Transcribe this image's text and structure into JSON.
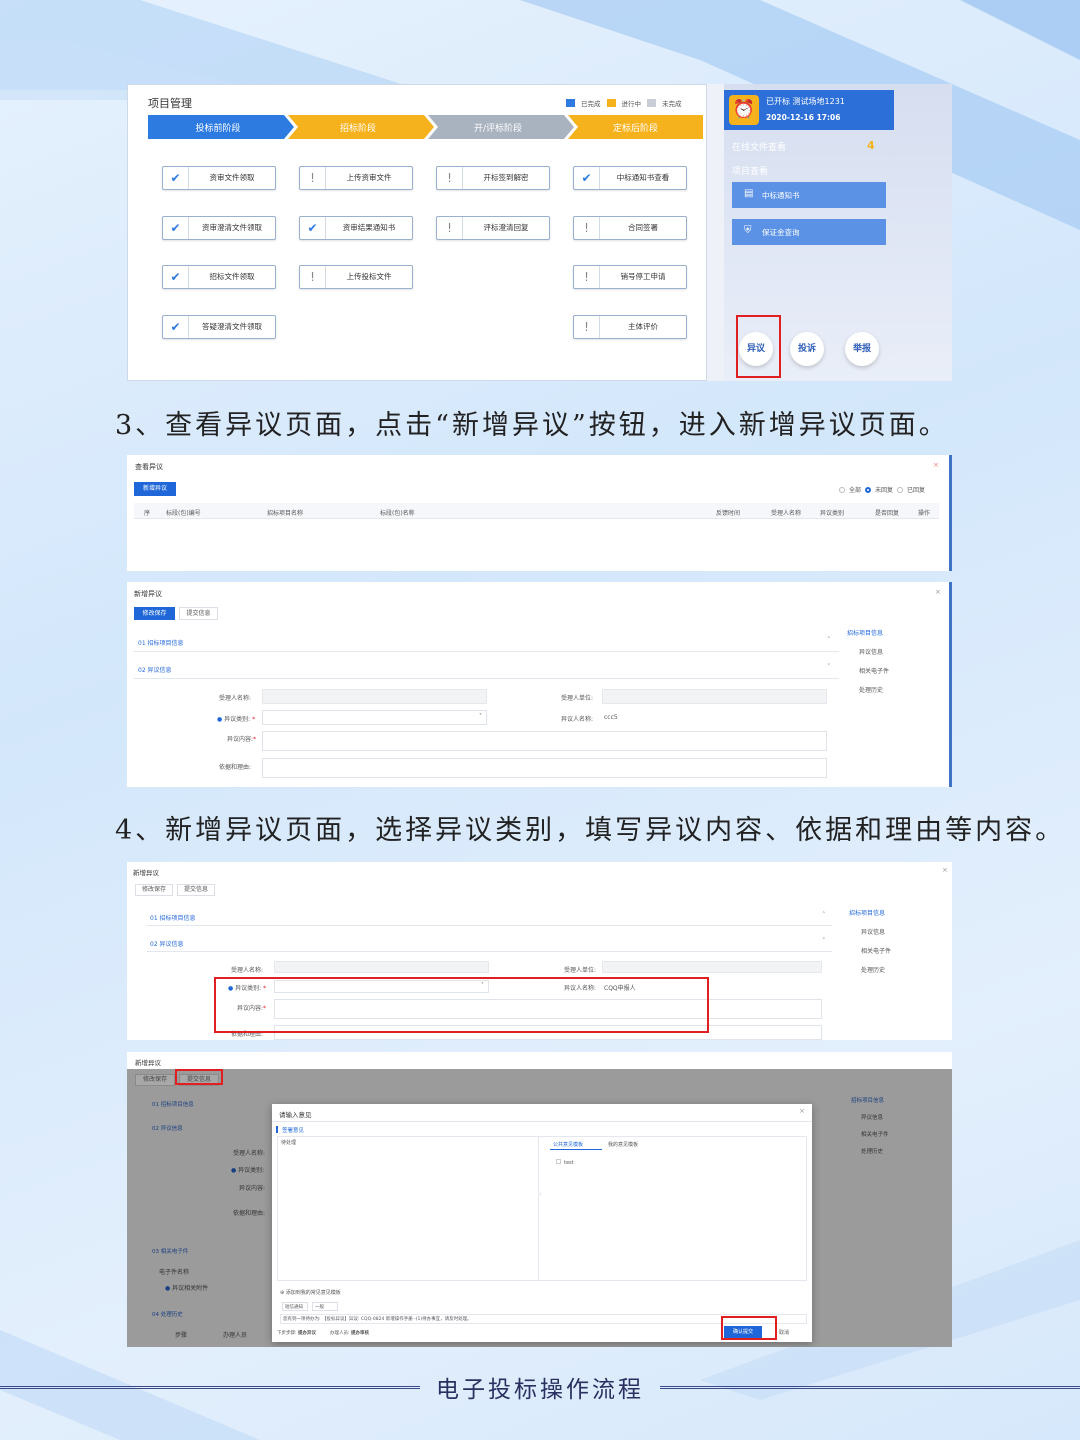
{
  "footer_title": "电子投标操作流程",
  "captions": {
    "step3": "3、查看异议页面，点击“新增异议”按钮，进入新增异议页面。",
    "step4": "4、新增异议页面，选择异议类别，填写异议内容、依据和理由等内容。"
  },
  "shot1": {
    "title": "项目管理",
    "legend": [
      "已完成",
      "进行中",
      "未完成"
    ],
    "stages": [
      "投标前阶段",
      "招标阶段",
      "开/评标阶段",
      "定标后阶段"
    ],
    "tasks": {
      "col1": [
        "资审文件领取",
        "资审澄清文件领取",
        "招标文件领取",
        "答疑澄清文件领取"
      ],
      "col2": [
        "上传资审文件",
        "资审结果通知书",
        "上传投标文件"
      ],
      "col3": [
        "开标签到解密",
        "评标澄清回复"
      ],
      "col4": [
        "中标通知书查看",
        "合同签署",
        "销号停工申请",
        "主体评价"
      ]
    },
    "status": {
      "line1": "已开标 测试场地1231",
      "datetime": "2020-12-16 17:06"
    },
    "online_docs": {
      "label": "在线文件查看",
      "count": "4"
    },
    "project_view": "项目查看",
    "buttons": [
      "中标通知书",
      "保证金查询"
    ],
    "actions": [
      "异议",
      "投诉",
      "举报"
    ]
  },
  "shot2": {
    "title": "查看异议",
    "new_button": "新增异议",
    "filters": [
      "全部",
      "未回复",
      "已回复"
    ],
    "columns": [
      "序",
      "标段(包)编号",
      "招标项目名称",
      "标段(包)名称",
      "反馈时间",
      "受理人名称",
      "异议类别",
      "是否回复",
      "操作"
    ]
  },
  "shot3": {
    "title": "新增异议",
    "buttons": [
      "修改保存",
      "提交信息"
    ],
    "sections": [
      "01  招标项目信息",
      "02  异议信息"
    ],
    "side_nav": [
      "招标项目信息",
      "异议信息",
      "相关电子件",
      "处理历史"
    ],
    "fields": {
      "receiver_name": "受理人名称:",
      "receiver_unit": "受理人单位:",
      "category": "异议类别:",
      "objector_name": "异议人名称:",
      "objector_value": "ccc5",
      "content": "异议内容:",
      "basis": "依据和理由:"
    }
  },
  "shot4": {
    "title": "新增异议",
    "buttons": [
      "修改保存",
      "提交信息"
    ],
    "sections": [
      "01  招标项目信息",
      "02  异议信息"
    ],
    "side_nav": [
      "招标项目信息",
      "异议信息",
      "相关电子件",
      "处理历史"
    ],
    "fields": {
      "receiver_name": "受理人名称:",
      "receiver_unit": "受理人单位:",
      "category": "异议类别:",
      "objector_name": "异议人名称:",
      "objector_value": "CQQ申报人",
      "content": "异议内容:",
      "basis": "依据和理由:"
    }
  },
  "shot5": {
    "title": "新增异议",
    "buttons": [
      "修改保存",
      "提交信息"
    ],
    "sections": [
      "01  招标项目信息",
      "02  异议信息",
      "03  相关电子件",
      "04  处理历史"
    ],
    "side_nav": [
      "招标项目信息",
      "异议信息",
      "相关电子件",
      "处理历史"
    ],
    "bg_fields": [
      "受理人名称:",
      "异议类别:",
      "异议内容:",
      "依据和理由:"
    ],
    "bg_misc": [
      "电子件名称",
      "异议相关附件",
      "步骤",
      "办理人员"
    ],
    "dialog": {
      "title": "请输入意见",
      "section": "签署意见",
      "pending": "待处理",
      "tabs": [
        "公共意见模板",
        "我的意见模板"
      ],
      "template_item": "test",
      "add_common": "添加到我的常见意见模板",
      "selects": [
        "短信通知",
        "一般"
      ],
      "message": "您有到一项待办为: 【投标异议】异议: CQQ-0824 新增操作手册 -(1)待办事宜，请及时处理。",
      "next_step_label": "下步步骤:",
      "next_step": "提办异议",
      "handler_label": "办理人员:",
      "handler": "提办审核",
      "confirm": "确认提交",
      "cancel": "取消"
    }
  }
}
